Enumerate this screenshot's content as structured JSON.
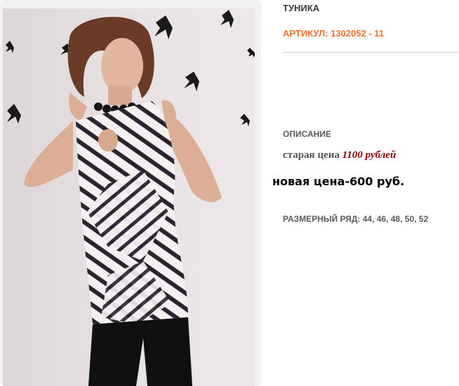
{
  "product": {
    "title": "ТУНИКА",
    "sku": "АРТИКУЛ: 1302052 - 11",
    "description_heading": "ОПИСАНИЕ",
    "old_price_label": "старая цена ",
    "old_price_value": "1100 рублей",
    "new_price": "новая цена-600 руб.",
    "sizes": "РАЗМЕРНЫЙ РЯД: 44, 46, 48, 50, 52",
    "photo_icon": "product-photo"
  },
  "colors": {
    "sku": "#f07030",
    "old_price_value": "#8b0000",
    "text": "#5a5a5a"
  }
}
